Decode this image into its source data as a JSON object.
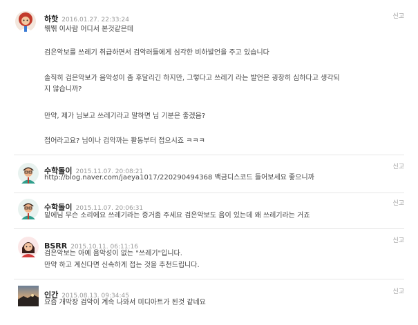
{
  "report_label": "신고",
  "comments": [
    {
      "author": "하핫",
      "date": "2016.01.27. 22:33:24",
      "lines": [
        "붺붺 이사람 어디서 본것같은데",
        "검은악보를 쓰레기 취급하면서 검악러들에게 심각한 비하발언을 주고 있습니다",
        "솔직히 검은악보가 음악성이 좀 후달리긴 하지만, 그렇다고 쓰레기 라는 발언은 굉장히 심하다고 생각되",
        "지 않습니까?",
        "만약, 제가 님보고 쓰레기라고 말하면 님 기분은 좋겠음?",
        "접어라고요? 님이나 검악까는 활동부터 접으시죠 ㅋㅋㅋ"
      ]
    },
    {
      "author": "수학돌이",
      "date": "2015.11.07. 20:08:21",
      "lines": [
        "http://blog.naver.com/jaeya1017/220290494368 백금디스코드 들어보세요 좋으니까"
      ]
    },
    {
      "author": "수학돌이",
      "date": "2015.11.07. 20:06:31",
      "lines": [
        "밑에님 무슨 소리에요 쓰레기라는 증거좀 주세요 검은악보도 음이 있는데 왜 쓰레기라는 거죠"
      ]
    },
    {
      "author": "BSRR",
      "date": "2015.10.11. 06:11:16",
      "lines": [
        "검은악보는 아예 음악성이 없는 \"쓰레기\"입니다.",
        "만약 하고 계신다면 신속하게 접는 것을 추천드립니다."
      ]
    },
    {
      "author": "인간",
      "date": "2015.08.13. 09:34:45",
      "lines": [
        "요즘 개막장 검악이 계속 나와서 미디아트가 된것 같네요"
      ]
    }
  ]
}
